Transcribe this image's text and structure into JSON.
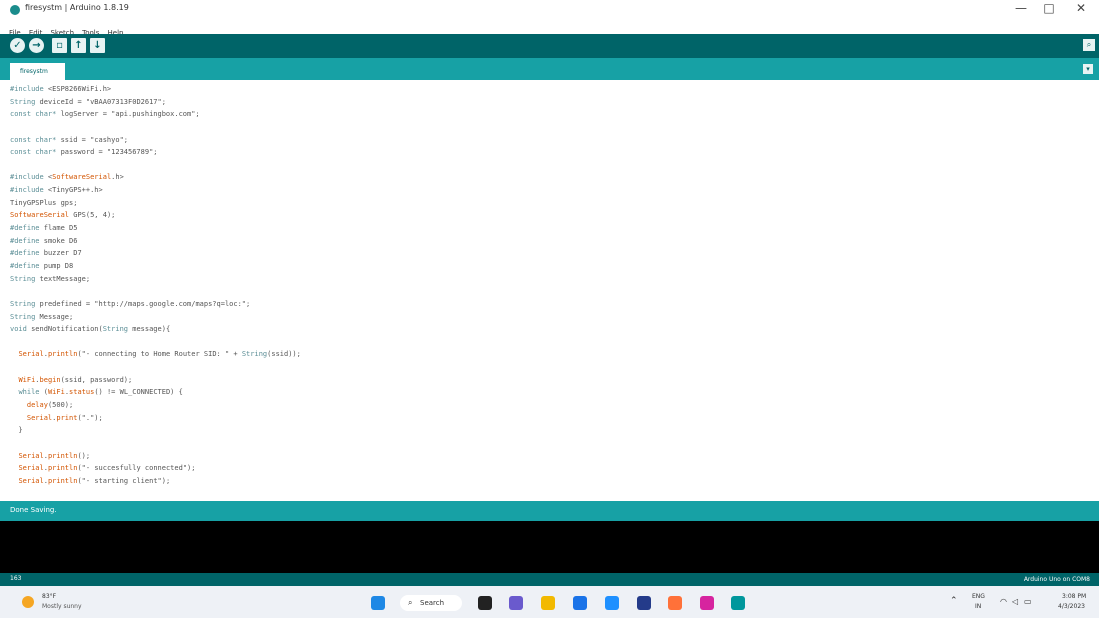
{
  "window": {
    "title": "firesystm | Arduino 1.8.19",
    "controls": {
      "minimize": "—",
      "maximize": "□",
      "close": "✕"
    }
  },
  "menu": [
    "File",
    "Edit",
    "Sketch",
    "Tools",
    "Help"
  ],
  "toolbar": {
    "verify_icon": "check-icon",
    "upload_icon": "arrow-right-icon",
    "new_icon": "new-file-icon",
    "open_icon": "arrow-up-icon",
    "save_icon": "arrow-down-icon",
    "serial_icon": "magnifier-icon"
  },
  "tabs": [
    {
      "label": "firesystm"
    }
  ],
  "code_lines": [
    [
      {
        "t": "#include",
        "c": "teal"
      },
      {
        "t": " <ESP8266WiFi.h>",
        "c": "str"
      }
    ],
    [
      {
        "t": "String",
        "c": "teal"
      },
      {
        "t": " deviceId = \"vBAA07313F0D2617\";",
        "c": "str"
      }
    ],
    [
      {
        "t": "const char*",
        "c": "teal"
      },
      {
        "t": " logServer = \"api.pushingbox.com\";",
        "c": "str"
      }
    ],
    [],
    [
      {
        "t": "const char*",
        "c": "teal"
      },
      {
        "t": " ssid = \"cashyo\";",
        "c": "str"
      }
    ],
    [
      {
        "t": "const char*",
        "c": "teal"
      },
      {
        "t": " password = \"123456789\";",
        "c": "str"
      }
    ],
    [],
    [
      {
        "t": "#include",
        "c": "teal"
      },
      {
        "t": " <",
        "c": "str"
      },
      {
        "t": "SoftwareSerial",
        "c": "orange"
      },
      {
        "t": ".h>",
        "c": "str"
      }
    ],
    [
      {
        "t": "#include",
        "c": "teal"
      },
      {
        "t": " <TinyGPS++.h>",
        "c": "str"
      }
    ],
    [
      {
        "t": "TinyGPSPlus gps;",
        "c": "str"
      }
    ],
    [
      {
        "t": "SoftwareSerial",
        "c": "orange"
      },
      {
        "t": " GPS(5, 4);",
        "c": "str"
      }
    ],
    [
      {
        "t": "#define",
        "c": "teal"
      },
      {
        "t": " flame D5",
        "c": "str"
      }
    ],
    [
      {
        "t": "#define",
        "c": "teal"
      },
      {
        "t": " smoke D6",
        "c": "str"
      }
    ],
    [
      {
        "t": "#define",
        "c": "teal"
      },
      {
        "t": " buzzer D7",
        "c": "str"
      }
    ],
    [
      {
        "t": "#define",
        "c": "teal"
      },
      {
        "t": " pump D8",
        "c": "str"
      }
    ],
    [
      {
        "t": "String",
        "c": "teal"
      },
      {
        "t": " textMessage;",
        "c": "str"
      }
    ],
    [],
    [
      {
        "t": "String",
        "c": "teal"
      },
      {
        "t": " predefined = \"http://maps.google.com/maps?q=loc:\";",
        "c": "str"
      }
    ],
    [
      {
        "t": "String",
        "c": "teal"
      },
      {
        "t": " Message;",
        "c": "str"
      }
    ],
    [
      {
        "t": "void",
        "c": "teal"
      },
      {
        "t": " sendNotification(",
        "c": "str"
      },
      {
        "t": "String",
        "c": "teal"
      },
      {
        "t": " message){",
        "c": "str"
      }
    ],
    [],
    [
      {
        "t": "  ",
        "c": "str"
      },
      {
        "t": "Serial",
        "c": "orange"
      },
      {
        "t": ".",
        "c": "str"
      },
      {
        "t": "println",
        "c": "orange"
      },
      {
        "t": "(\"- connecting to Home Router SID: \" + ",
        "c": "str"
      },
      {
        "t": "String",
        "c": "teal"
      },
      {
        "t": "(ssid));",
        "c": "str"
      }
    ],
    [],
    [
      {
        "t": "  ",
        "c": "str"
      },
      {
        "t": "WiFi",
        "c": "orange"
      },
      {
        "t": ".",
        "c": "str"
      },
      {
        "t": "begin",
        "c": "orange"
      },
      {
        "t": "(ssid, password);",
        "c": "str"
      }
    ],
    [
      {
        "t": "  ",
        "c": "str"
      },
      {
        "t": "while",
        "c": "teal"
      },
      {
        "t": " (",
        "c": "str"
      },
      {
        "t": "WiFi",
        "c": "orange"
      },
      {
        "t": ".",
        "c": "str"
      },
      {
        "t": "status",
        "c": "orange"
      },
      {
        "t": "() != WL_CONNECTED) {",
        "c": "str"
      }
    ],
    [
      {
        "t": "    ",
        "c": "str"
      },
      {
        "t": "delay",
        "c": "orange"
      },
      {
        "t": "(500);",
        "c": "str"
      }
    ],
    [
      {
        "t": "    ",
        "c": "str"
      },
      {
        "t": "Serial",
        "c": "orange"
      },
      {
        "t": ".",
        "c": "str"
      },
      {
        "t": "print",
        "c": "orange"
      },
      {
        "t": "(\".\");",
        "c": "str"
      }
    ],
    [
      {
        "t": "  }",
        "c": "str"
      }
    ],
    [],
    [
      {
        "t": "  ",
        "c": "str"
      },
      {
        "t": "Serial",
        "c": "orange"
      },
      {
        "t": ".",
        "c": "str"
      },
      {
        "t": "println",
        "c": "orange"
      },
      {
        "t": "();",
        "c": "str"
      }
    ],
    [
      {
        "t": "  ",
        "c": "str"
      },
      {
        "t": "Serial",
        "c": "orange"
      },
      {
        "t": ".",
        "c": "str"
      },
      {
        "t": "println",
        "c": "orange"
      },
      {
        "t": "(\"- succesfully connected\");",
        "c": "str"
      }
    ],
    [
      {
        "t": "  ",
        "c": "str"
      },
      {
        "t": "Serial",
        "c": "orange"
      },
      {
        "t": ".",
        "c": "str"
      },
      {
        "t": "println",
        "c": "orange"
      },
      {
        "t": "(\"- starting client\");",
        "c": "str"
      }
    ]
  ],
  "status": {
    "message": "Done Saving."
  },
  "footer": {
    "line": "163",
    "board": "Arduino Uno on COM8"
  },
  "taskbar": {
    "weather": {
      "temp": "83°F",
      "desc": "Mostly sunny"
    },
    "search_label": "Search",
    "apps": [
      {
        "icon": "windows-start-icon",
        "color": "#1e88e5"
      },
      {
        "icon": "task-view-icon",
        "color": "#222222"
      },
      {
        "icon": "chat-icon",
        "color": "#6a5acd"
      },
      {
        "icon": "file-explorer-icon",
        "color": "#f2b900"
      },
      {
        "icon": "edge-icon",
        "color": "#1a73e8"
      },
      {
        "icon": "chrome-icon",
        "color": "#1e90ff"
      },
      {
        "icon": "store-icon",
        "color": "#243b8a"
      },
      {
        "icon": "firefox-icon",
        "color": "#ff7139"
      },
      {
        "icon": "instagram-icon",
        "color": "#d6249f"
      },
      {
        "icon": "arduino-icon",
        "color": "#00979c"
      }
    ],
    "lang_top": "ENG",
    "lang_bottom": "IN",
    "time": "3:08 PM",
    "date": "4/3/2023"
  },
  "colors": {
    "toolbar": "#006468",
    "tabbar": "#17a1a5",
    "console": "#000000",
    "keyword": "#5b8e96",
    "function": "#d35400"
  }
}
